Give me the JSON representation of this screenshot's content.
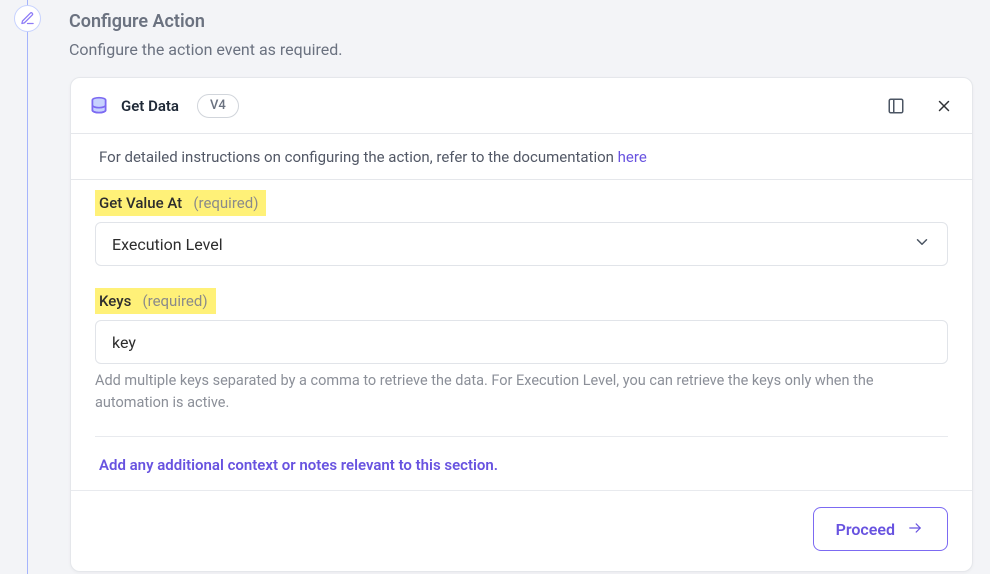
{
  "header": {
    "title": "Configure Action",
    "subtitle": "Configure the action event as required."
  },
  "card": {
    "title": "Get Data",
    "version": "V4",
    "doc_prefix": "For detailed instructions on configuring the action, refer to the documentation ",
    "doc_link": "here"
  },
  "fields": {
    "get_value_at": {
      "label": "Get Value At",
      "required_text": "(required)",
      "value": "Execution Level"
    },
    "keys": {
      "label": "Keys",
      "required_text": "(required)",
      "value": "key",
      "helper": "Add multiple keys separated by a comma to retrieve the data. For Execution Level, you can retrieve the keys only when the automation is active."
    }
  },
  "context_link": "Add any additional context or notes relevant to this section.",
  "footer": {
    "proceed": "Proceed"
  }
}
